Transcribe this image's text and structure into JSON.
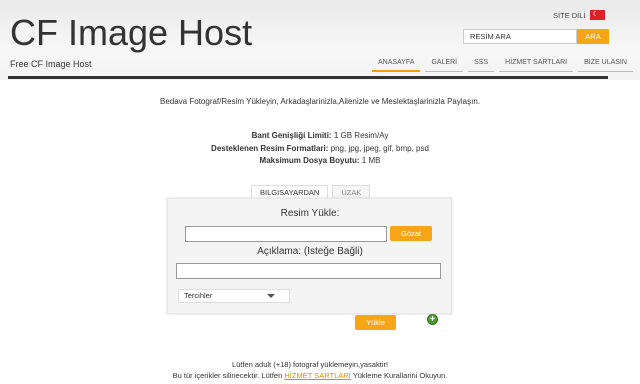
{
  "header": {
    "title": "CF Image Host",
    "subtitle": "Free CF Image Host",
    "lang_label": "SİTE DİLİ",
    "flag_icon": "turkey-flag-icon"
  },
  "search": {
    "value": "RESİM ARA",
    "button": "ARA"
  },
  "nav": {
    "items": [
      "ANASAYFA",
      "GALERİ",
      "SSS",
      "HİZMET SARTLARI",
      "BİZE ULASIN"
    ],
    "active": "ANASAYFA"
  },
  "intro": "Bedava Fotograf/Resim Yükleyin, Arkadaşlarinizla,Ailenizle ve Meslektaşlarinizla Paylaşın.",
  "limits": {
    "bandwidth_label": "Bant Genişliği Limiti:",
    "bandwidth_value": "1 GB Resim/Ay",
    "formats_label": "Desteklenen Resim Formatlari:",
    "formats_value": "png, jpg, jpeg, gif, bmp, psd",
    "maxsize_label": "Maksimum Dosya Boyutu:",
    "maxsize_value": "1 MB"
  },
  "tabs": [
    "BILGISAYARDAN",
    "UZAK"
  ],
  "form": {
    "upload_label": "Resim Yükle:",
    "browse_button": "Gözat",
    "desc_label": "Açıklama: (Isteğe Bağli)",
    "options_select": "Tercihler",
    "upload_button": "Yükle"
  },
  "warning": {
    "line1": "Lütfen adult (+18) fotograf yüklemeyin,yasaktir!",
    "line2_pre": "Bu tür içerikler silinecektir. Lütfen",
    "line2_link": "HİZMET SARTLARI",
    "line2_post": "Yükleme Kurallarini Okuyun."
  },
  "colors": {
    "accent": "#f5a516",
    "divider": "#333333",
    "add_green": "#4a9d2a"
  }
}
